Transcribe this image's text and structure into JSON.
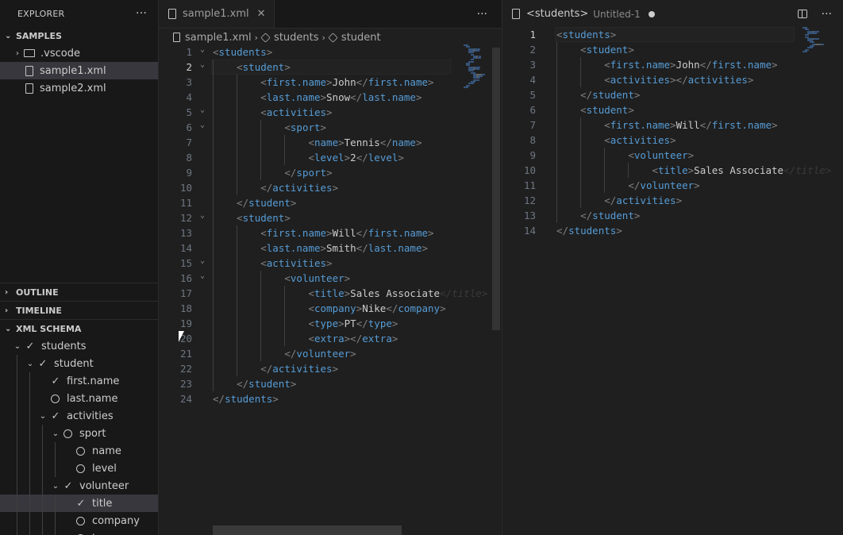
{
  "explorer": {
    "title": "EXPLORER",
    "more": "···",
    "samples_section": "SAMPLES",
    "items": [
      {
        "label": ".vscode",
        "kind": "folder"
      },
      {
        "label": "sample1.xml",
        "kind": "file",
        "selected": true
      },
      {
        "label": "sample2.xml",
        "kind": "file"
      }
    ],
    "outline": "OUTLINE",
    "timeline": "TIMELINE",
    "schema_section": "XML SCHEMA"
  },
  "schema_tree": [
    {
      "label": "students",
      "state": "check",
      "chevron": true,
      "depth": 0
    },
    {
      "label": "student",
      "state": "check",
      "chevron": true,
      "depth": 1
    },
    {
      "label": "first.name",
      "state": "check",
      "chevron": false,
      "depth": 2
    },
    {
      "label": "last.name",
      "state": "circle",
      "chevron": false,
      "depth": 2
    },
    {
      "label": "activities",
      "state": "check",
      "chevron": true,
      "depth": 2
    },
    {
      "label": "sport",
      "state": "circle",
      "chevron": true,
      "depth": 3
    },
    {
      "label": "name",
      "state": "circle",
      "chevron": false,
      "depth": 4
    },
    {
      "label": "level",
      "state": "circle",
      "chevron": false,
      "depth": 4
    },
    {
      "label": "volunteer",
      "state": "check",
      "chevron": true,
      "depth": 3
    },
    {
      "label": "title",
      "state": "check",
      "chevron": false,
      "depth": 4,
      "selected": true
    },
    {
      "label": "company",
      "state": "circle",
      "chevron": false,
      "depth": 4
    },
    {
      "label": "type",
      "state": "circle",
      "chevron": false,
      "depth": 4
    }
  ],
  "left_editor": {
    "tab": {
      "name": "sample1.xml",
      "close": "✕"
    },
    "more": "···",
    "breadcrumb": [
      "sample1.xml",
      "students",
      "student"
    ],
    "current_line": 2,
    "lines": [
      {
        "n": "1",
        "indent": 0,
        "fold": true,
        "parts": [
          [
            "p",
            "<"
          ],
          [
            "t",
            "students"
          ],
          [
            "p",
            ">"
          ]
        ]
      },
      {
        "n": "2",
        "indent": 1,
        "fold": true,
        "parts": [
          [
            "p",
            "<"
          ],
          [
            "t",
            "student"
          ],
          [
            "p",
            ">"
          ]
        ]
      },
      {
        "n": "3",
        "indent": 2,
        "fold": false,
        "parts": [
          [
            "p",
            "<"
          ],
          [
            "t",
            "first.name"
          ],
          [
            "p",
            ">"
          ],
          [
            "x",
            "John"
          ],
          [
            "p",
            "</"
          ],
          [
            "t",
            "first.name"
          ],
          [
            "p",
            ">"
          ]
        ]
      },
      {
        "n": "4",
        "indent": 2,
        "fold": false,
        "parts": [
          [
            "p",
            "<"
          ],
          [
            "t",
            "last.name"
          ],
          [
            "p",
            ">"
          ],
          [
            "x",
            "Snow"
          ],
          [
            "p",
            "</"
          ],
          [
            "t",
            "last.name"
          ],
          [
            "p",
            ">"
          ]
        ]
      },
      {
        "n": "5",
        "indent": 2,
        "fold": true,
        "parts": [
          [
            "p",
            "<"
          ],
          [
            "t",
            "activities"
          ],
          [
            "p",
            ">"
          ]
        ]
      },
      {
        "n": "6",
        "indent": 3,
        "fold": true,
        "parts": [
          [
            "p",
            "<"
          ],
          [
            "t",
            "sport"
          ],
          [
            "p",
            ">"
          ]
        ]
      },
      {
        "n": "7",
        "indent": 4,
        "fold": false,
        "parts": [
          [
            "p",
            "<"
          ],
          [
            "t",
            "name"
          ],
          [
            "p",
            ">"
          ],
          [
            "x",
            "Tennis"
          ],
          [
            "p",
            "</"
          ],
          [
            "t",
            "name"
          ],
          [
            "p",
            ">"
          ]
        ]
      },
      {
        "n": "8",
        "indent": 4,
        "fold": false,
        "parts": [
          [
            "p",
            "<"
          ],
          [
            "t",
            "level"
          ],
          [
            "p",
            ">"
          ],
          [
            "x",
            "2"
          ],
          [
            "p",
            "</"
          ],
          [
            "t",
            "level"
          ],
          [
            "p",
            ">"
          ]
        ]
      },
      {
        "n": "9",
        "indent": 3,
        "fold": false,
        "parts": [
          [
            "p",
            "</"
          ],
          [
            "t",
            "sport"
          ],
          [
            "p",
            ">"
          ]
        ]
      },
      {
        "n": "10",
        "indent": 2,
        "fold": false,
        "parts": [
          [
            "p",
            "</"
          ],
          [
            "t",
            "activities"
          ],
          [
            "p",
            ">"
          ]
        ]
      },
      {
        "n": "11",
        "indent": 1,
        "fold": false,
        "parts": [
          [
            "p",
            "</"
          ],
          [
            "t",
            "student"
          ],
          [
            "p",
            ">"
          ]
        ]
      },
      {
        "n": "12",
        "indent": 1,
        "fold": true,
        "parts": [
          [
            "p",
            "<"
          ],
          [
            "t",
            "student"
          ],
          [
            "p",
            ">"
          ]
        ]
      },
      {
        "n": "13",
        "indent": 2,
        "fold": false,
        "parts": [
          [
            "p",
            "<"
          ],
          [
            "t",
            "first.name"
          ],
          [
            "p",
            ">"
          ],
          [
            "x",
            "Will"
          ],
          [
            "p",
            "</"
          ],
          [
            "t",
            "first.name"
          ],
          [
            "p",
            ">"
          ]
        ]
      },
      {
        "n": "14",
        "indent": 2,
        "fold": false,
        "parts": [
          [
            "p",
            "<"
          ],
          [
            "t",
            "last.name"
          ],
          [
            "p",
            ">"
          ],
          [
            "x",
            "Smith"
          ],
          [
            "p",
            "</"
          ],
          [
            "t",
            "last.name"
          ],
          [
            "p",
            ">"
          ]
        ]
      },
      {
        "n": "15",
        "indent": 2,
        "fold": true,
        "parts": [
          [
            "p",
            "<"
          ],
          [
            "t",
            "activities"
          ],
          [
            "p",
            ">"
          ]
        ]
      },
      {
        "n": "16",
        "indent": 3,
        "fold": true,
        "parts": [
          [
            "p",
            "<"
          ],
          [
            "t",
            "volunteer"
          ],
          [
            "p",
            ">"
          ]
        ]
      },
      {
        "n": "17",
        "indent": 4,
        "fold": false,
        "parts": [
          [
            "p",
            "<"
          ],
          [
            "t",
            "title"
          ],
          [
            "p",
            ">"
          ],
          [
            "x",
            "Sales Associate"
          ],
          [
            "g",
            "</title>"
          ]
        ]
      },
      {
        "n": "18",
        "indent": 4,
        "fold": false,
        "parts": [
          [
            "p",
            "<"
          ],
          [
            "t",
            "company"
          ],
          [
            "p",
            ">"
          ],
          [
            "x",
            "Nike"
          ],
          [
            "p",
            "</"
          ],
          [
            "t",
            "company"
          ],
          [
            "p",
            ">"
          ]
        ]
      },
      {
        "n": "19",
        "indent": 4,
        "fold": false,
        "parts": [
          [
            "p",
            "<"
          ],
          [
            "t",
            "type"
          ],
          [
            "p",
            ">"
          ],
          [
            "x",
            "PT"
          ],
          [
            "p",
            "</"
          ],
          [
            "t",
            "type"
          ],
          [
            "p",
            ">"
          ]
        ]
      },
      {
        "n": "20",
        "indent": 4,
        "fold": false,
        "parts": [
          [
            "p",
            "<"
          ],
          [
            "t",
            "extra"
          ],
          [
            "p",
            "></"
          ],
          [
            "t",
            "extra"
          ],
          [
            "p",
            ">"
          ]
        ]
      },
      {
        "n": "21",
        "indent": 3,
        "fold": false,
        "parts": [
          [
            "p",
            "</"
          ],
          [
            "t",
            "volunteer"
          ],
          [
            "p",
            ">"
          ]
        ]
      },
      {
        "n": "22",
        "indent": 2,
        "fold": false,
        "parts": [
          [
            "p",
            "</"
          ],
          [
            "t",
            "activities"
          ],
          [
            "p",
            ">"
          ]
        ]
      },
      {
        "n": "23",
        "indent": 1,
        "fold": false,
        "parts": [
          [
            "p",
            "</"
          ],
          [
            "t",
            "student"
          ],
          [
            "p",
            ">"
          ]
        ]
      },
      {
        "n": "24",
        "indent": 0,
        "fold": false,
        "parts": [
          [
            "p",
            "</"
          ],
          [
            "t",
            "students"
          ],
          [
            "p",
            ">"
          ]
        ]
      }
    ]
  },
  "right_editor": {
    "tab": {
      "name": "<students>",
      "sub": "Untitled-1"
    },
    "current_line": 1,
    "lines": [
      {
        "n": "1",
        "indent": 0,
        "parts": [
          [
            "p",
            "<"
          ],
          [
            "t",
            "students"
          ],
          [
            "p",
            ">"
          ]
        ]
      },
      {
        "n": "2",
        "indent": 1,
        "parts": [
          [
            "p",
            "<"
          ],
          [
            "t",
            "student"
          ],
          [
            "p",
            ">"
          ]
        ]
      },
      {
        "n": "3",
        "indent": 2,
        "parts": [
          [
            "p",
            "<"
          ],
          [
            "t",
            "first.name"
          ],
          [
            "p",
            ">"
          ],
          [
            "x",
            "John"
          ],
          [
            "p",
            "</"
          ],
          [
            "t",
            "first.name"
          ],
          [
            "p",
            ">"
          ]
        ]
      },
      {
        "n": "4",
        "indent": 2,
        "parts": [
          [
            "p",
            "<"
          ],
          [
            "t",
            "activities"
          ],
          [
            "p",
            "></"
          ],
          [
            "t",
            "activities"
          ],
          [
            "p",
            ">"
          ]
        ]
      },
      {
        "n": "5",
        "indent": 1,
        "parts": [
          [
            "p",
            "</"
          ],
          [
            "t",
            "student"
          ],
          [
            "p",
            ">"
          ]
        ]
      },
      {
        "n": "6",
        "indent": 1,
        "parts": [
          [
            "p",
            "<"
          ],
          [
            "t",
            "student"
          ],
          [
            "p",
            ">"
          ]
        ]
      },
      {
        "n": "7",
        "indent": 2,
        "parts": [
          [
            "p",
            "<"
          ],
          [
            "t",
            "first.name"
          ],
          [
            "p",
            ">"
          ],
          [
            "x",
            "Will"
          ],
          [
            "p",
            "</"
          ],
          [
            "t",
            "first.name"
          ],
          [
            "p",
            ">"
          ]
        ]
      },
      {
        "n": "8",
        "indent": 2,
        "parts": [
          [
            "p",
            "<"
          ],
          [
            "t",
            "activities"
          ],
          [
            "p",
            ">"
          ]
        ]
      },
      {
        "n": "9",
        "indent": 3,
        "parts": [
          [
            "p",
            "<"
          ],
          [
            "t",
            "volunteer"
          ],
          [
            "p",
            ">"
          ]
        ]
      },
      {
        "n": "10",
        "indent": 4,
        "parts": [
          [
            "p",
            "<"
          ],
          [
            "t",
            "title"
          ],
          [
            "p",
            ">"
          ],
          [
            "x",
            "Sales Associate"
          ],
          [
            "g",
            "</title>"
          ]
        ]
      },
      {
        "n": "11",
        "indent": 3,
        "parts": [
          [
            "p",
            "</"
          ],
          [
            "t",
            "volunteer"
          ],
          [
            "p",
            ">"
          ]
        ]
      },
      {
        "n": "12",
        "indent": 2,
        "parts": [
          [
            "p",
            "</"
          ],
          [
            "t",
            "activities"
          ],
          [
            "p",
            ">"
          ]
        ]
      },
      {
        "n": "13",
        "indent": 1,
        "parts": [
          [
            "p",
            "</"
          ],
          [
            "t",
            "student"
          ],
          [
            "p",
            ">"
          ]
        ]
      },
      {
        "n": "14",
        "indent": 0,
        "parts": [
          [
            "p",
            "</"
          ],
          [
            "t",
            "students"
          ],
          [
            "p",
            ">"
          ]
        ]
      }
    ]
  }
}
